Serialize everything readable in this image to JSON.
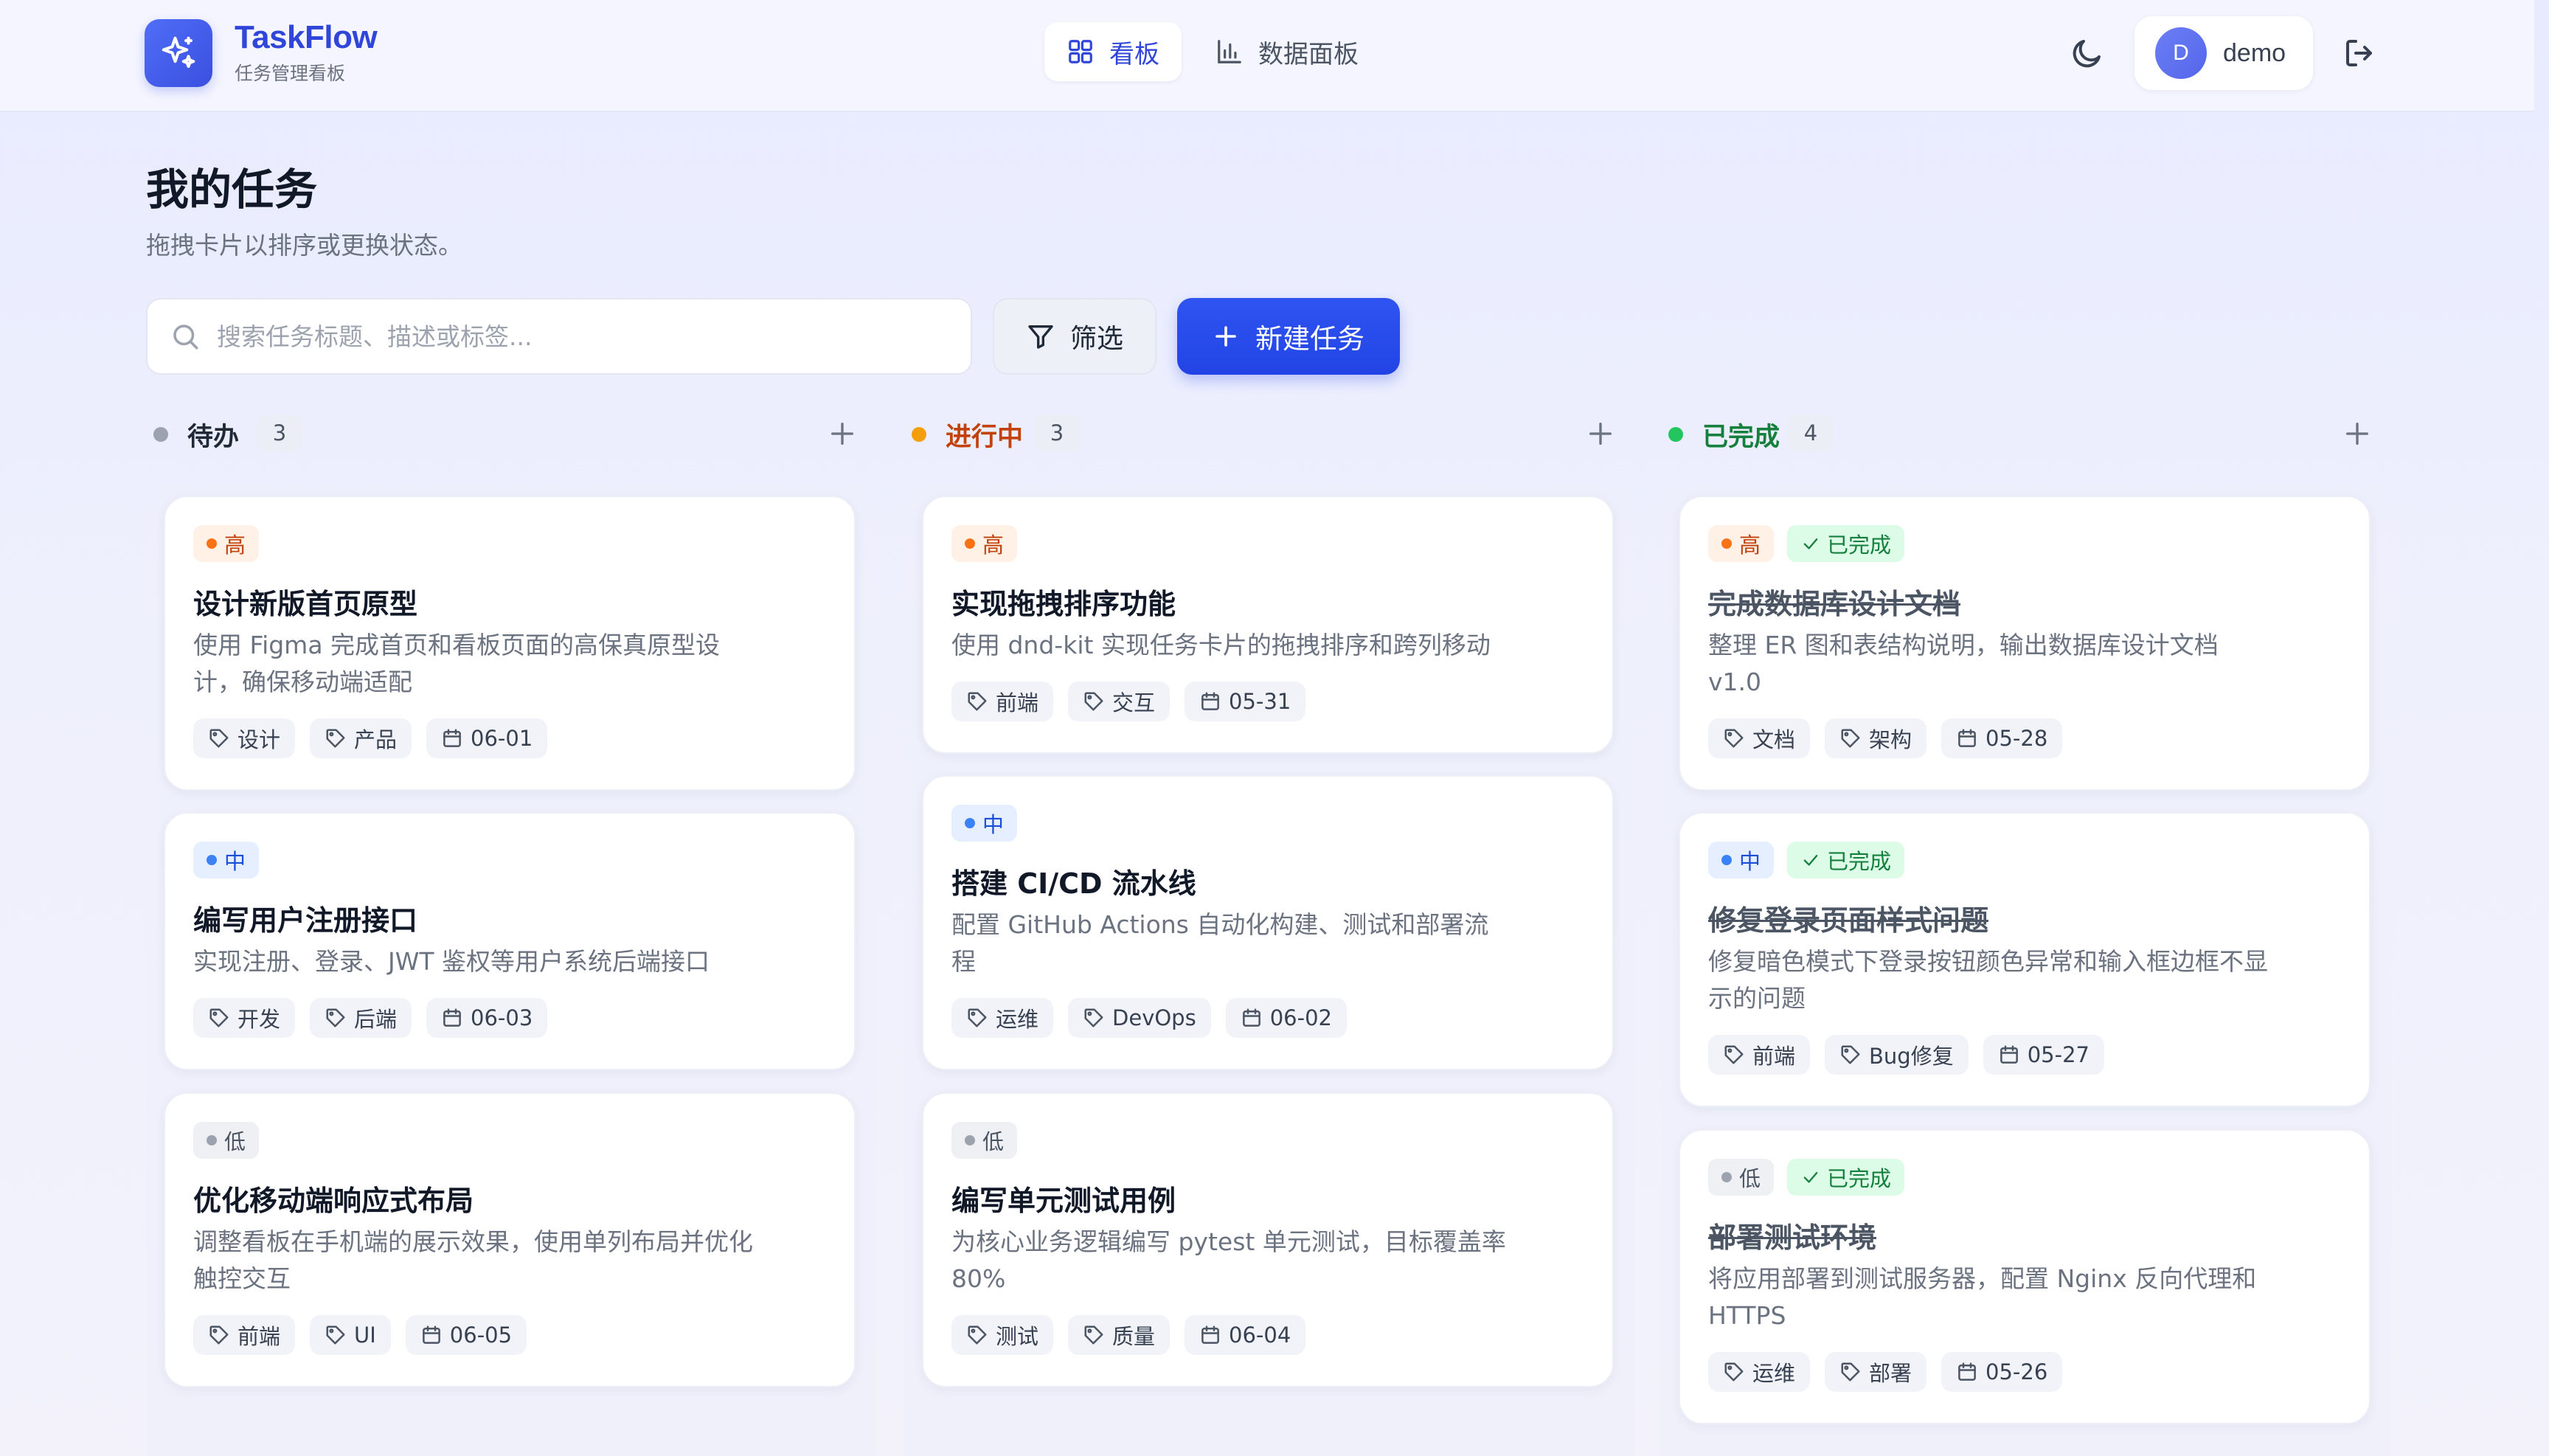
{
  "app": {
    "name": "TaskFlow",
    "subtitle": "任务管理看板"
  },
  "nav": {
    "board_label": "看板",
    "dashboard_label": "数据面板"
  },
  "user": {
    "initial": "D",
    "name": "demo"
  },
  "page": {
    "title": "我的任务",
    "subtitle": "拖拽卡片以排序或更换状态。"
  },
  "toolbar": {
    "search_placeholder": "搜索任务标题、描述或标签...",
    "filter_label": "筛选",
    "new_task_label": "新建任务"
  },
  "colors": {
    "accent": "#2f54f0",
    "todo": "#9ca3af",
    "in_progress": "#f59e0b",
    "done": "#22c55e"
  },
  "columns": [
    {
      "title": "待办",
      "count": "3",
      "title_color": "#1f2937",
      "dot_color": "#9ca3af",
      "cards": [
        {
          "priority": "高",
          "priority_level": "high",
          "title": "设计新版首页原型",
          "description": "使用 Figma 完成首页和看板页面的高保真原型设计，确保移动端适配",
          "tags": [
            "设计",
            "产品"
          ],
          "date": "06-01"
        },
        {
          "priority": "中",
          "priority_level": "mid",
          "title": "编写用户注册接口",
          "description": "实现注册、登录、JWT 鉴权等用户系统后端接口",
          "tags": [
            "开发",
            "后端"
          ],
          "date": "06-03"
        },
        {
          "priority": "低",
          "priority_level": "low",
          "title": "优化移动端响应式布局",
          "description": "调整看板在手机端的展示效果，使用单列布局并优化触控交互",
          "tags": [
            "前端",
            "UI"
          ],
          "date": "06-05"
        }
      ]
    },
    {
      "title": "进行中",
      "count": "3",
      "title_color": "#c2410c",
      "dot_color": "#f59e0b",
      "cards": [
        {
          "priority": "高",
          "priority_level": "high",
          "title": "实现拖拽排序功能",
          "description": "使用 dnd-kit 实现任务卡片的拖拽排序和跨列移动",
          "tags": [
            "前端",
            "交互"
          ],
          "date": "05-31"
        },
        {
          "priority": "中",
          "priority_level": "mid",
          "title": "搭建 CI/CD 流水线",
          "description": "配置 GitHub Actions 自动化构建、测试和部署流程",
          "tags": [
            "运维",
            "DevOps"
          ],
          "date": "06-02"
        },
        {
          "priority": "低",
          "priority_level": "low",
          "title": "编写单元测试用例",
          "description": "为核心业务逻辑编写 pytest 单元测试，目标覆盖率 80%",
          "tags": [
            "测试",
            "质量"
          ],
          "date": "06-04"
        }
      ]
    },
    {
      "title": "已完成",
      "count": "4",
      "title_color": "#15803d",
      "dot_color": "#22c55e",
      "done_label": "已完成",
      "cards": [
        {
          "priority": "高",
          "priority_level": "high",
          "title": "完成数据库设计文档",
          "description": "整理 ER 图和表结构说明，输出数据库设计文档 v1.0",
          "tags": [
            "文档",
            "架构"
          ],
          "date": "05-28"
        },
        {
          "priority": "中",
          "priority_level": "mid",
          "title": "修复登录页面样式问题",
          "description": "修复暗色模式下登录按钮颜色异常和输入框边框不显示的问题",
          "tags": [
            "前端",
            "Bug修复"
          ],
          "date": "05-27"
        },
        {
          "priority": "低",
          "priority_level": "low",
          "title": "部署测试环境",
          "description": "将应用部署到测试服务器，配置 Nginx 反向代理和 HTTPS",
          "tags": [
            "运维",
            "部署"
          ],
          "date": "05-26"
        }
      ]
    }
  ]
}
